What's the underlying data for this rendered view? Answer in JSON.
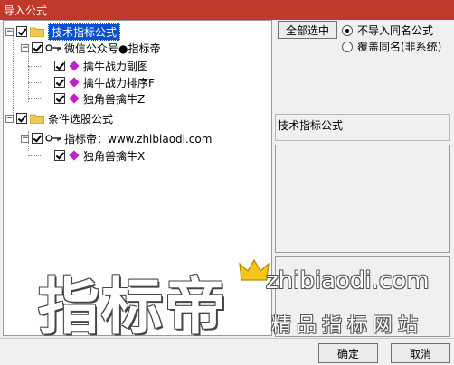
{
  "window": {
    "title": "导入公式"
  },
  "tree": {
    "root1": {
      "label": "技术指标公式",
      "toggle": "−"
    },
    "group1": {
      "label": "微信公众号●指标帝",
      "toggle": "−"
    },
    "items1": [
      "擒牛战力副图",
      "擒牛战力排序F",
      "独角兽擒牛Z"
    ],
    "root2": {
      "label": "条件选股公式",
      "toggle": "−"
    },
    "group2": {
      "label": "指标帝：www.zhibiaodi.com",
      "toggle": "−"
    },
    "items2": [
      "独角兽擒牛X"
    ]
  },
  "options": {
    "select_all_button": "全部选中",
    "radio1": "不导入同名公式",
    "radio2": "覆盖同名(非系统)",
    "selected": "radio1"
  },
  "info": {
    "category": "技术指标公式"
  },
  "footer": {
    "ok": "确定",
    "cancel": "取消"
  },
  "watermark": {
    "brand": "指标帝",
    "url": "zhibiaodi.com",
    "slogan": "精品指标网站"
  },
  "colors": {
    "titlebar": "#c0392b",
    "selection": "#0a50d0",
    "gem": "#c020c8",
    "folder": "#f2c94c"
  }
}
